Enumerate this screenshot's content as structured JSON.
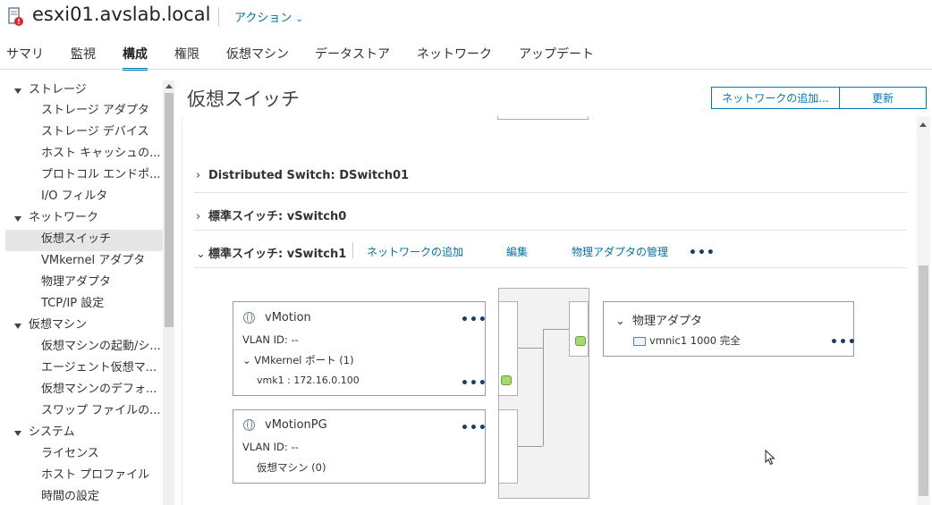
{
  "header": {
    "host": "esxi01.avslab.local",
    "actions": "アクション"
  },
  "tabs": [
    "サマリ",
    "監視",
    "構成",
    "権限",
    "仮想マシン",
    "データストア",
    "ネットワーク",
    "アップデート"
  ],
  "active_tab": "構成",
  "sidebar": {
    "storage": {
      "label": "ストレージ",
      "items": [
        "ストレージ アダプタ",
        "ストレージ デバイス",
        "ホスト キャッシュの...",
        "プロトコル エンドポ...",
        "I/O フィルタ"
      ]
    },
    "network": {
      "label": "ネットワーク",
      "items": [
        "仮想スイッチ",
        "VMkernel アダプタ",
        "物理アダプタ",
        "TCP/IP 設定"
      ]
    },
    "vm": {
      "label": "仮想マシン",
      "items": [
        "仮想マシンの起動/シ...",
        "エージェント仮想マ...",
        "仮想マシンのデフォ...",
        "スワップ ファイルの..."
      ]
    },
    "system": {
      "label": "システム",
      "items": [
        "ライセンス",
        "ホスト プロファイル",
        "時間の設定"
      ]
    }
  },
  "main": {
    "title": "仮想スイッチ",
    "add_network_button": "ネットワークの追加...",
    "refresh_button": "更新",
    "switches": [
      {
        "label": "Distributed Switch: DSwitch01"
      },
      {
        "label": "標準スイッチ: vSwitch0"
      },
      {
        "label": "標準スイッチ: vSwitch1"
      }
    ],
    "switch_actions": {
      "add_network": "ネットワークの追加",
      "edit": "編集",
      "manage_physical": "物理アダプタの管理"
    },
    "portgroups": [
      {
        "name": "vMotion",
        "vlan": "VLAN ID: --",
        "ports_label": "VMkernel ポート (1)",
        "port_item": "vmk1 : 172.16.0.100"
      },
      {
        "name": "vMotionPG",
        "vlan": "VLAN ID: --",
        "vms_label": "仮想マシン (0)"
      }
    ],
    "physical": {
      "label": "物理アダプタ",
      "adapter": "vmnic1 1000 完全"
    }
  },
  "colors": {
    "accent": "#0079b8",
    "port": "#a6d86e"
  }
}
